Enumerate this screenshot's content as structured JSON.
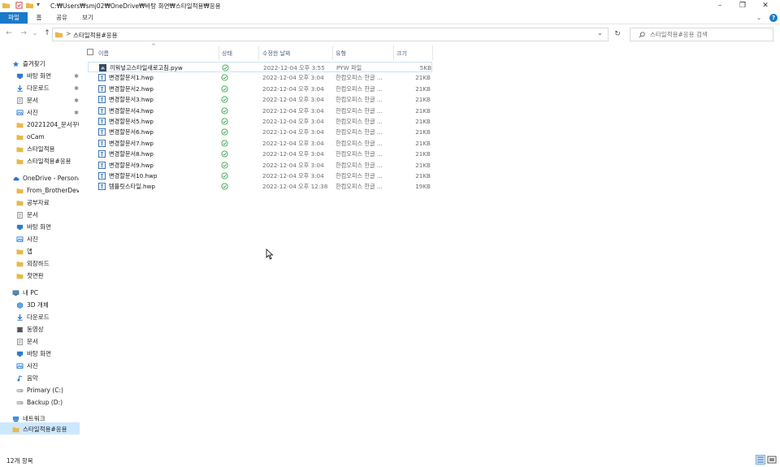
{
  "window": {
    "title": "C:₩Users₩smj02₩OneDrive₩바탕 화면₩스타일적용₩응용",
    "minimize": "–",
    "maximize": "❐",
    "close": "✕"
  },
  "ribbon": {
    "tabs": [
      "파일",
      "홈",
      "공유",
      "보기"
    ],
    "expand": "⌄",
    "help": "?"
  },
  "nav": {
    "back": "←",
    "forward": "→",
    "recent": "⌄",
    "up": "↑",
    "breadcrumb_sep": ">",
    "breadcrumb": "스타일적용#응용",
    "address_dropdown": "⌄",
    "refresh": "↻",
    "search_placeholder": "스타일적용#응용 검색"
  },
  "sidebar": {
    "items": [
      {
        "label": "즐겨찾기",
        "icon": "star-icon",
        "pinned": false
      },
      {
        "label": "바탕 화면",
        "icon": "desktop-icon",
        "pinned": true
      },
      {
        "label": "다운로드",
        "icon": "download-icon",
        "pinned": true
      },
      {
        "label": "문서",
        "icon": "document-icon",
        "pinned": true
      },
      {
        "label": "사진",
        "icon": "picture-icon",
        "pinned": true
      },
      {
        "label": "20221204_문서꾸미",
        "icon": "folder-icon",
        "pinned": false
      },
      {
        "label": "oCam",
        "icon": "folder-icon",
        "pinned": false
      },
      {
        "label": "스타일적용",
        "icon": "folder-icon",
        "pinned": false
      },
      {
        "label": "스타일적용#응용",
        "icon": "folder-icon",
        "pinned": false
      },
      {
        "label": "OneDrive - Personal",
        "icon": "cloud-icon",
        "pinned": false
      },
      {
        "label": "From_BrotherDevice",
        "icon": "folder-icon",
        "pinned": false
      },
      {
        "label": "공부자료",
        "icon": "folder-icon",
        "pinned": false
      },
      {
        "label": "문서",
        "icon": "document-icon",
        "pinned": false
      },
      {
        "label": "바탕 화면",
        "icon": "desktop-icon",
        "pinned": false
      },
      {
        "label": "사진",
        "icon": "picture-icon",
        "pinned": false
      },
      {
        "label": "앱",
        "icon": "folder-icon",
        "pinned": false
      },
      {
        "label": "외장하드",
        "icon": "folder-icon",
        "pinned": false
      },
      {
        "label": "첫면판",
        "icon": "folder-icon",
        "pinned": false
      },
      {
        "label": "내 PC",
        "icon": "pc-icon",
        "pinned": false
      },
      {
        "label": "3D 개체",
        "icon": "cube-icon",
        "pinned": false
      },
      {
        "label": "다운로드",
        "icon": "download-icon",
        "pinned": false
      },
      {
        "label": "동영상",
        "icon": "video-icon",
        "pinned": false
      },
      {
        "label": "문서",
        "icon": "document-icon",
        "pinned": false
      },
      {
        "label": "바탕 화면",
        "icon": "desktop-icon",
        "pinned": false
      },
      {
        "label": "사진",
        "icon": "picture-icon",
        "pinned": false
      },
      {
        "label": "음악",
        "icon": "music-icon",
        "pinned": false
      },
      {
        "label": "Primary (C:)",
        "icon": "drive-icon",
        "pinned": false
      },
      {
        "label": "Backup (D:)",
        "icon": "drive-icon",
        "pinned": false
      },
      {
        "label": "네트워크",
        "icon": "network-icon",
        "pinned": false
      },
      {
        "label": "스타일적용#응용",
        "icon": "folder-icon",
        "pinned": false
      }
    ],
    "pin_glyph": "✱"
  },
  "columns": {
    "name": "이름",
    "status": "상태",
    "date": "수정한 날짜",
    "type": "유형",
    "size": "크기",
    "sort_glyph": "^"
  },
  "files": [
    {
      "name": "끼워넣고스타일새로고침.pyw",
      "date": "2022-12-04 오후 3:55",
      "type": "PYW 파일",
      "size": "5KB",
      "icon": "python-file-icon"
    },
    {
      "name": "변경할문서1.hwp",
      "date": "2022-12-04 오후 3:04",
      "type": "한컴오피스 한글 ...",
      "size": "21KB",
      "icon": "hwp-file-icon"
    },
    {
      "name": "변경할문서2.hwp",
      "date": "2022-12-04 오후 3:04",
      "type": "한컴오피스 한글 ...",
      "size": "21KB",
      "icon": "hwp-file-icon"
    },
    {
      "name": "변경할문서3.hwp",
      "date": "2022-12-04 오후 3:04",
      "type": "한컴오피스 한글 ...",
      "size": "21KB",
      "icon": "hwp-file-icon"
    },
    {
      "name": "변경할문서4.hwp",
      "date": "2022-12-04 오후 3:04",
      "type": "한컴오피스 한글 ...",
      "size": "21KB",
      "icon": "hwp-file-icon"
    },
    {
      "name": "변경할문서5.hwp",
      "date": "2022-12-04 오후 3:04",
      "type": "한컴오피스 한글 ...",
      "size": "21KB",
      "icon": "hwp-file-icon"
    },
    {
      "name": "변경할문서6.hwp",
      "date": "2022-12-04 오후 3:04",
      "type": "한컴오피스 한글 ...",
      "size": "21KB",
      "icon": "hwp-file-icon"
    },
    {
      "name": "변경할문서7.hwp",
      "date": "2022-12-04 오후 3:04",
      "type": "한컴오피스 한글 ...",
      "size": "21KB",
      "icon": "hwp-file-icon"
    },
    {
      "name": "변경할문서8.hwp",
      "date": "2022-12-04 오후 3:04",
      "type": "한컴오피스 한글 ...",
      "size": "21KB",
      "icon": "hwp-file-icon"
    },
    {
      "name": "변경할문서9.hwp",
      "date": "2022-12-04 오후 3:04",
      "type": "한컴오피스 한글 ...",
      "size": "21KB",
      "icon": "hwp-file-icon"
    },
    {
      "name": "변경할문서10.hwp",
      "date": "2022-12-04 오후 3:04",
      "type": "한컴오피스 한글 ...",
      "size": "21KB",
      "icon": "hwp-file-icon"
    },
    {
      "name": "템플릿스타일.hwp",
      "date": "2022-12-04 오후 12:38",
      "type": "한컴오피스 한글 ...",
      "size": "19KB",
      "icon": "hwp-file-icon"
    }
  ],
  "status_bar": {
    "count": "12개 항목"
  },
  "colors": {
    "accent": "#1979ca",
    "selection": "#cce8ff",
    "folder": "#e8b94a",
    "sync_green": "#3aa34a"
  }
}
